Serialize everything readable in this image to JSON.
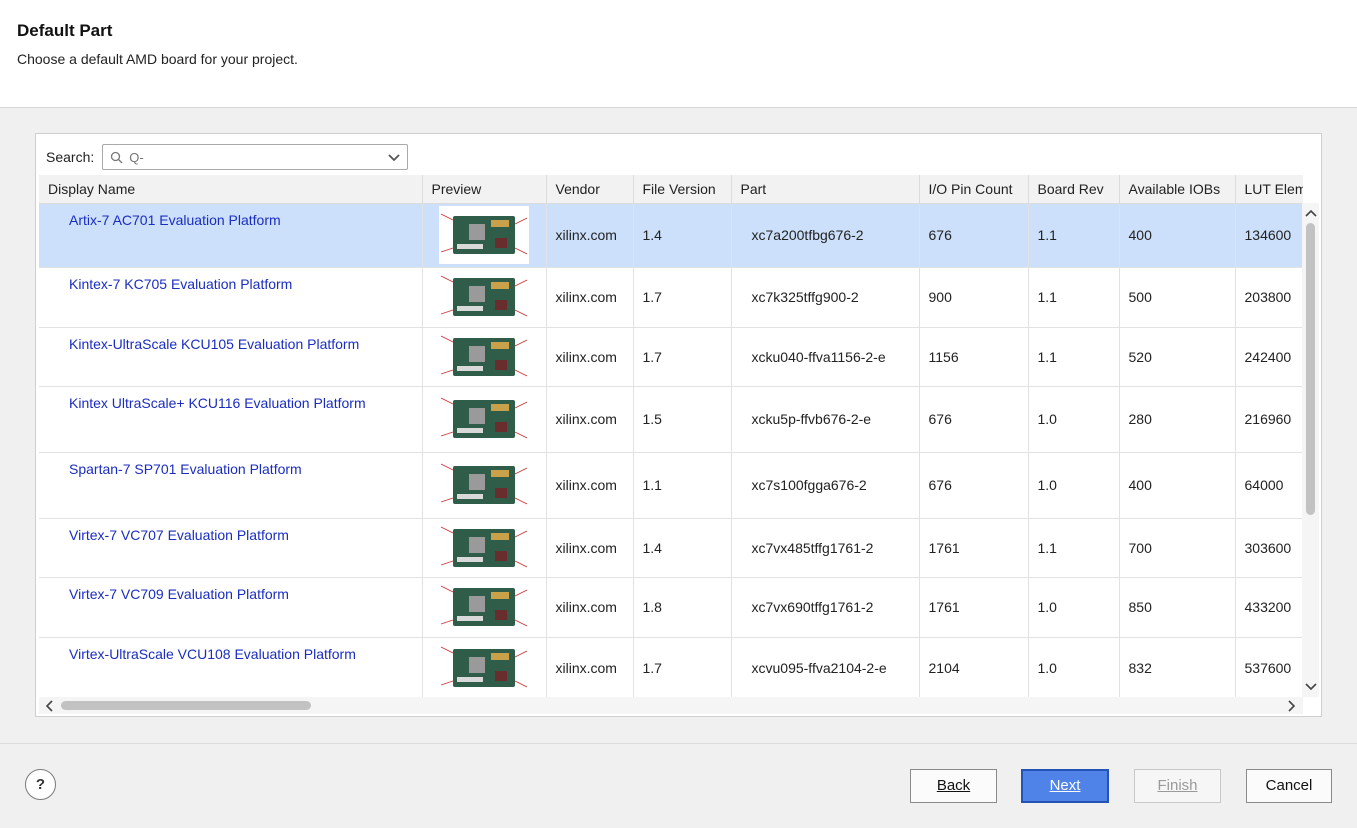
{
  "header": {
    "title": "Default Part",
    "subtitle": "Choose a default AMD board for your project."
  },
  "search": {
    "label": "Search:",
    "value": "",
    "placeholder": "Q-"
  },
  "table": {
    "columns": [
      "Display Name",
      "Preview",
      "Vendor",
      "File Version",
      "Part",
      "I/O Pin Count",
      "Board Rev",
      "Available IOBs",
      "LUT Elements"
    ],
    "rows": [
      {
        "name": "Artix-7 AC701 Evaluation Platform",
        "vendor": "xilinx.com",
        "version": "1.4",
        "part": "xc7a200tfbg676-2",
        "pins": "676",
        "rev": "1.1",
        "iobs": "400",
        "lut": "134600"
      },
      {
        "name": "Kintex-7 KC705 Evaluation Platform",
        "vendor": "xilinx.com",
        "version": "1.7",
        "part": "xc7k325tffg900-2",
        "pins": "900",
        "rev": "1.1",
        "iobs": "500",
        "lut": "203800"
      },
      {
        "name": "Kintex-UltraScale KCU105 Evaluation Platform",
        "vendor": "xilinx.com",
        "version": "1.7",
        "part": "xcku040-ffva1156-2-e",
        "pins": "1156",
        "rev": "1.1",
        "iobs": "520",
        "lut": "242400"
      },
      {
        "name": "Kintex UltraScale+ KCU116 Evaluation Platform",
        "vendor": "xilinx.com",
        "version": "1.5",
        "part": "xcku5p-ffvb676-2-e",
        "pins": "676",
        "rev": "1.0",
        "iobs": "280",
        "lut": "216960"
      },
      {
        "name": "Spartan-7 SP701 Evaluation Platform",
        "vendor": "xilinx.com",
        "version": "1.1",
        "part": "xc7s100fgga676-2",
        "pins": "676",
        "rev": "1.0",
        "iobs": "400",
        "lut": "64000"
      },
      {
        "name": "Virtex-7 VC707 Evaluation Platform",
        "vendor": "xilinx.com",
        "version": "1.4",
        "part": "xc7vx485tffg1761-2",
        "pins": "1761",
        "rev": "1.1",
        "iobs": "700",
        "lut": "303600"
      },
      {
        "name": "Virtex-7 VC709 Evaluation Platform",
        "vendor": "xilinx.com",
        "version": "1.8",
        "part": "xc7vx690tffg1761-2",
        "pins": "1761",
        "rev": "1.0",
        "iobs": "850",
        "lut": "433200"
      },
      {
        "name": "Virtex-UltraScale VCU108 Evaluation Platform",
        "vendor": "xilinx.com",
        "version": "1.7",
        "part": "xcvu095-ffva2104-2-e",
        "pins": "2104",
        "rev": "1.0",
        "iobs": "832",
        "lut": "537600"
      }
    ]
  },
  "footer": {
    "help_label": "?",
    "back_label": "Back",
    "next_label": "Next",
    "finish_label": "Finish",
    "cancel_label": "Cancel"
  },
  "colors": {
    "link": "#1a2dbf",
    "selected_row": "#cce0fb",
    "primary_button": "#4f83e8"
  }
}
